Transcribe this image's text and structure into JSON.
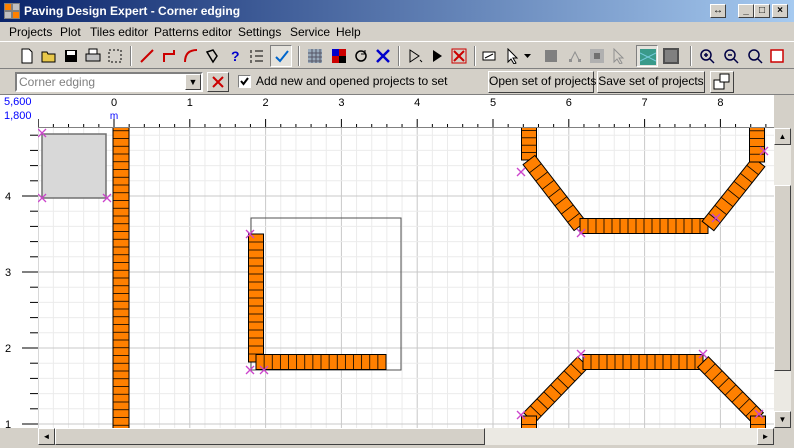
{
  "window": {
    "title": "Paving Design Expert - Corner edging",
    "restore_glyph": "↔",
    "minimize_glyph": "_",
    "maximize_glyph": "□",
    "close_glyph": "×"
  },
  "menu": [
    "Projects",
    "Plot",
    "Tiles editor",
    "Patterns editor",
    "Settings",
    "Service",
    "Help"
  ],
  "toolbar_icons": [
    "new-icon",
    "open-folder-icon",
    "save-icon",
    "print-icon",
    "select-area-icon",
    "line-icon",
    "corner-line-icon",
    "arc-icon",
    "polyline-icon",
    "help-query-icon",
    "numbered-list-icon",
    "check-icon",
    "grid-fill-icon",
    "color-pattern-icon",
    "rotate-icon",
    "delete-cross-icon",
    "step-icon",
    "play-icon",
    "stop-cross-icon",
    "erase-icon",
    "pointer-icon",
    "dropdown-arrow-icon",
    "tile-gray-icon",
    "node-icon",
    "tile-box-icon",
    "pointer-disabled-icon",
    "texture-icon",
    "tile-dark-icon",
    "zoom-in-icon",
    "zoom-out-icon",
    "zoom-fit-icon",
    "zoom-frame-icon"
  ],
  "project_selector": {
    "value": "Corner edging",
    "arrow": "▼"
  },
  "add_to_set": {
    "checked": true,
    "label": "Add new and opened projects to set"
  },
  "buttons": {
    "open_set": "Open set of projects",
    "save_set": "Save set of projects"
  },
  "scale": {
    "x": "5,600",
    "y": "1,800"
  },
  "ruler": {
    "unit": "m",
    "x_labels": [
      "0",
      "1",
      "2",
      "3",
      "4",
      "5",
      "6",
      "7",
      "8"
    ],
    "y_labels": [
      "4",
      "3",
      "2",
      "1"
    ]
  },
  "colors": {
    "tile_fill": "#ff8000",
    "tile_stroke": "#000000",
    "node_marker": "#cc44cc",
    "grid_minor": "#ebebeb",
    "grid_major": "#c8c8c8",
    "ruler_text": "#0000ff"
  },
  "scrollbars": {
    "up": "▲",
    "down": "▼",
    "left": "◄",
    "right": "►"
  }
}
